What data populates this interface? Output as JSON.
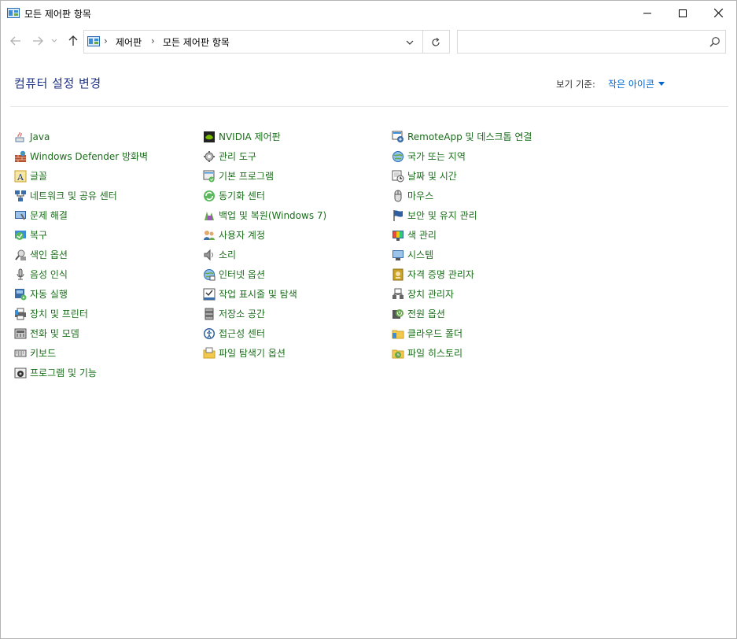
{
  "window": {
    "title": "모든 제어판 항목"
  },
  "address": {
    "crumbs": [
      "제어판",
      "모든 제어판 항목"
    ],
    "search_placeholder": ""
  },
  "header": {
    "heading": "컴퓨터 설정 변경",
    "viewby_label": "보기 기준:",
    "viewby_value": "작은 아이콘"
  },
  "items": {
    "col1": [
      {
        "label": "Java",
        "icon": "java-icon"
      },
      {
        "label": "Windows Defender 방화벽",
        "icon": "firewall-icon"
      },
      {
        "label": "글꼴",
        "icon": "fonts-icon"
      },
      {
        "label": "네트워크 및 공유 센터",
        "icon": "network-icon"
      },
      {
        "label": "문제 해결",
        "icon": "troubleshoot-icon"
      },
      {
        "label": "복구",
        "icon": "recovery-icon"
      },
      {
        "label": "색인 옵션",
        "icon": "indexing-icon"
      },
      {
        "label": "음성 인식",
        "icon": "microphone-icon"
      },
      {
        "label": "자동 실행",
        "icon": "autoplay-icon"
      },
      {
        "label": "장치 및 프린터",
        "icon": "printer-icon"
      },
      {
        "label": "전화 및 모뎀",
        "icon": "phone-icon"
      },
      {
        "label": "키보드",
        "icon": "keyboard-icon"
      },
      {
        "label": "프로그램 및 기능",
        "icon": "programs-icon"
      }
    ],
    "col2": [
      {
        "label": "NVIDIA 제어판",
        "icon": "nvidia-icon"
      },
      {
        "label": "관리 도구",
        "icon": "admin-tools-icon"
      },
      {
        "label": "기본 프로그램",
        "icon": "default-programs-icon"
      },
      {
        "label": "동기화 센터",
        "icon": "sync-icon"
      },
      {
        "label": "백업 및 복원(Windows 7)",
        "icon": "backup-icon"
      },
      {
        "label": "사용자 계정",
        "icon": "users-icon"
      },
      {
        "label": "소리",
        "icon": "speaker-icon"
      },
      {
        "label": "인터넷 옵션",
        "icon": "internet-icon"
      },
      {
        "label": "작업 표시줄 및 탐색",
        "icon": "taskbar-icon"
      },
      {
        "label": "저장소 공간",
        "icon": "storage-icon"
      },
      {
        "label": "접근성 센터",
        "icon": "accessibility-icon"
      },
      {
        "label": "파일 탐색기 옵션",
        "icon": "folder-options-icon"
      }
    ],
    "col3": [
      {
        "label": "RemoteApp 및 데스크톱 연결",
        "icon": "remoteapp-icon"
      },
      {
        "label": "국가 또는 지역",
        "icon": "region-icon"
      },
      {
        "label": "날짜 및 시간",
        "icon": "clock-icon"
      },
      {
        "label": "마우스",
        "icon": "mouse-icon"
      },
      {
        "label": "보안 및 유지 관리",
        "icon": "flag-icon"
      },
      {
        "label": "색 관리",
        "icon": "color-icon"
      },
      {
        "label": "시스템",
        "icon": "system-icon"
      },
      {
        "label": "자격 증명 관리자",
        "icon": "credential-icon"
      },
      {
        "label": "장치 관리자",
        "icon": "device-manager-icon"
      },
      {
        "label": "전원 옵션",
        "icon": "power-icon"
      },
      {
        "label": "클라우드 폴더",
        "icon": "cloud-folder-icon"
      },
      {
        "label": "파일 히스토리",
        "icon": "file-history-icon"
      }
    ]
  },
  "colors": {
    "heading": "#1e3287",
    "link": "#1a6e1a",
    "accent": "#0066cc"
  }
}
